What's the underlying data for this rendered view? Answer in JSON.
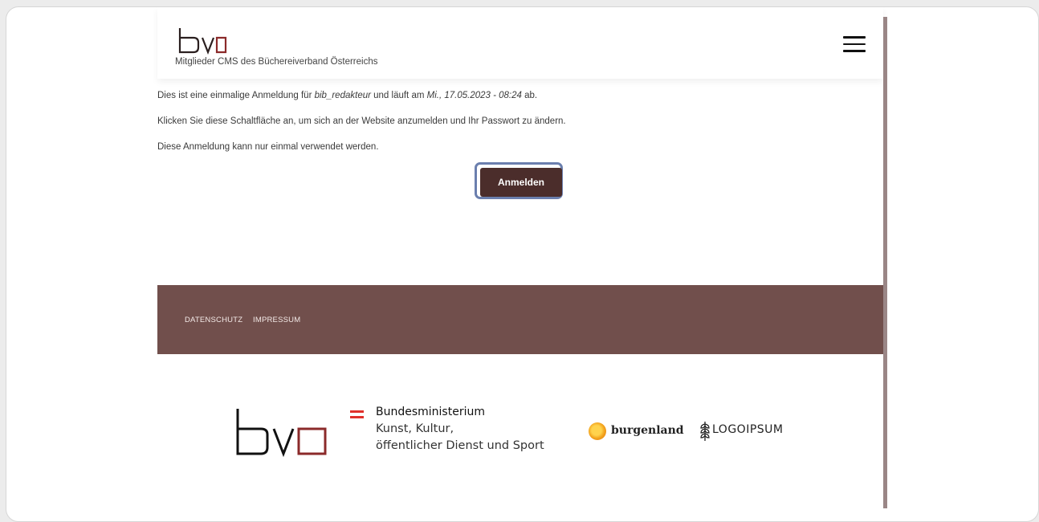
{
  "header": {
    "logo_text": "bvo",
    "logo_subtitle": "Mitglieder CMS des Büchereiverband Österreichs",
    "menu_icon": "hamburger-menu-icon"
  },
  "content": {
    "line1": {
      "prefix": "Dies ist eine einmalige Anmeldung für ",
      "username": "bib_redakteur",
      "middle": " und läuft am ",
      "expiry": "Mi., 17.05.2023 - 08:24",
      "suffix": " ab."
    },
    "line2": "Klicken Sie diese Schaltfläche an, um sich an der Website anzumelden und Ihr Passwort zu ändern.",
    "line3": "Diese Anmeldung kann nur einmal verwendet werden.",
    "login_button": "Anmelden"
  },
  "footer": {
    "links": [
      "DATENSCHUTZ",
      "IMPRESSUM"
    ]
  },
  "logos": {
    "bvo": "bvo",
    "ministry": {
      "title": "Bundesministerium",
      "line1": "Kunst, Kultur,",
      "line2": "öffentlicher Dienst und Sport"
    },
    "burgenland": "burgenland",
    "logoipsum": "LOGOIPSUM"
  },
  "colors": {
    "accent_brown": "#714f4c",
    "button": "#4b2d2b",
    "focus_ring": "#6b7fae",
    "logo_red": "#8b2a2a"
  }
}
